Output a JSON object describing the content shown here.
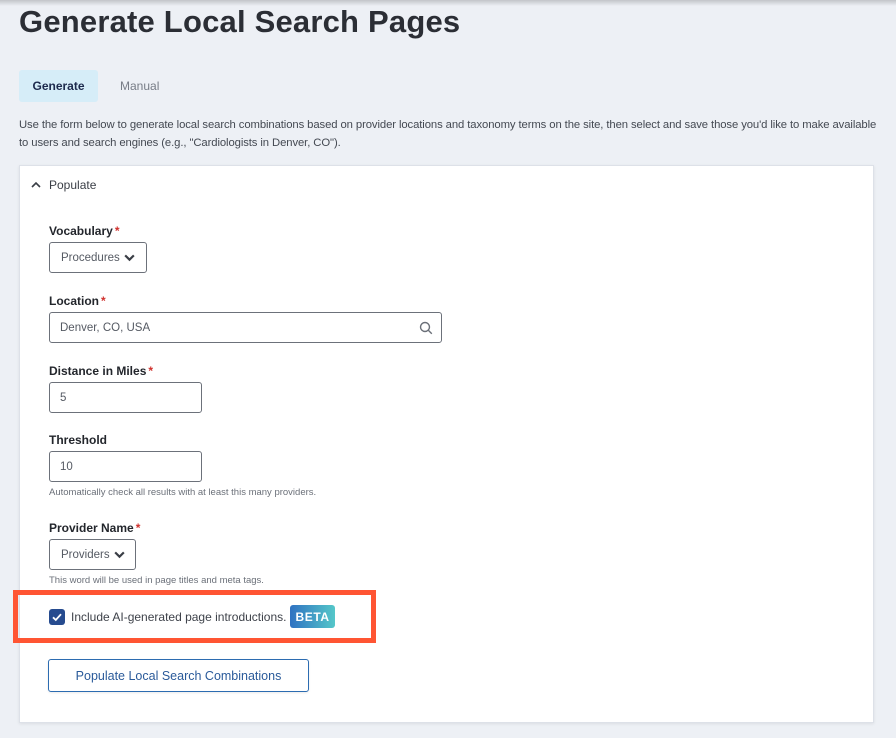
{
  "page": {
    "title": "Generate Local Search Pages",
    "intro": "Use the form below to generate local search combinations based on provider locations and taxonomy terms on the site, then select and save those you'd like to make available to users and search engines (e.g., \"Cardiologists in Denver, CO\")."
  },
  "tabs": [
    {
      "label": "Generate",
      "active": true
    },
    {
      "label": "Manual",
      "active": false
    }
  ],
  "panel": {
    "header": "Populate",
    "expanded": true,
    "fields": {
      "vocabulary": {
        "label": "Vocabulary",
        "required": "*",
        "value": "Procedures"
      },
      "location": {
        "label": "Location",
        "required": "*",
        "value": "Denver, CO, USA"
      },
      "distance": {
        "label": "Distance in Miles",
        "required": "*",
        "value": "5"
      },
      "threshold": {
        "label": "Threshold",
        "value": "10",
        "help": "Automatically check all results with at least this many providers."
      },
      "provider_name": {
        "label": "Provider Name",
        "required": "*",
        "value": "Providers",
        "help": "This word will be used in page titles and meta tags."
      }
    },
    "ai_intro": {
      "label": "Include AI-generated page introductions.",
      "checked": true,
      "badge": "BETA"
    },
    "submit_label": "Populate Local Search Combinations"
  },
  "colors": {
    "accent": "#264b8f",
    "highlight": "#ff5533",
    "tab_active_bg": "#d6edf8",
    "required": "#d0312d"
  }
}
